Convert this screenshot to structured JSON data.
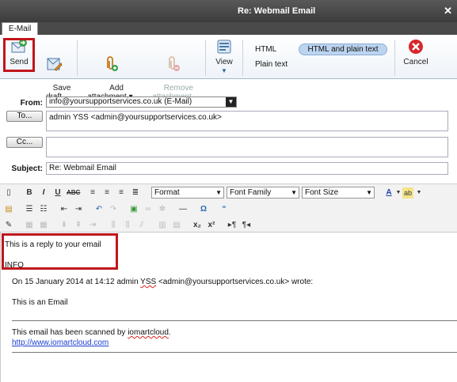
{
  "window": {
    "title": "Re: Webmail Email",
    "close": "✕",
    "tab": "E-Mail"
  },
  "ribbon": {
    "send": "Send",
    "save": "Save\ndraft",
    "add_attachment": "Add\nattachment ▾",
    "remove_attachment": "Remove\nattachment",
    "view": "View",
    "format_html": "HTML",
    "format_plain": "Plain text",
    "format_selected": "HTML and plain text",
    "cancel": "Cancel"
  },
  "header": {
    "from_label": "From:",
    "from_value": "info@yoursupportservices.co.uk (E-Mail)",
    "to_button": "To...",
    "to_value": "admin YSS <admin@yoursupportservices.co.uk>",
    "cc_button": "Cc...",
    "cc_value": "",
    "subject_label": "Subject:",
    "subject_value": "Re: Webmail Email"
  },
  "editor_toolbar": {
    "format": "Format",
    "font_family": "Font Family",
    "font_size": "Font Size"
  },
  "body": {
    "reply_line1": "This is a reply to your email",
    "reply_line2": "INFO",
    "quote_header_pre": "On 15 January 2014 at 14:12 admin ",
    "quote_header_yss": "YSS",
    "quote_header_post": " <admin@yoursupportservices.co.uk> wrote:",
    "quoted_text": "This is an Email",
    "scan_note_pre": "This email has been scanned by ",
    "scan_note_brand": "iomartcloud",
    "scan_note_post": ".",
    "scan_link": "http://www.iomartcloud.com"
  },
  "colors": {
    "highlight": "#c0161b",
    "titlebar": "#4a4a4a",
    "selected_format": "#bcd4f0"
  }
}
